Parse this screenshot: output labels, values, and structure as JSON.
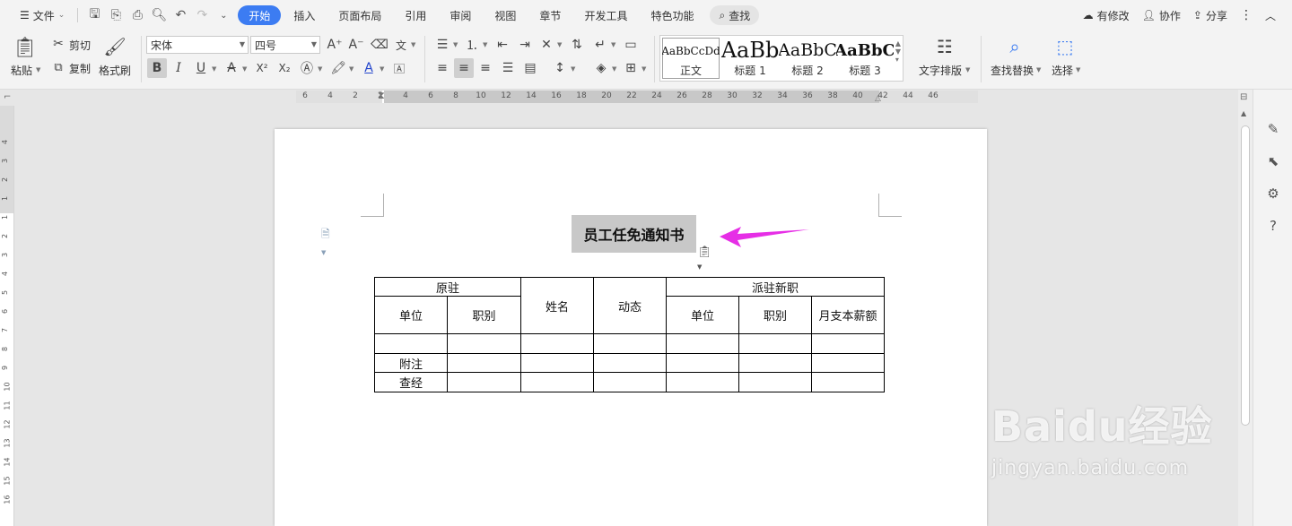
{
  "menubar": {
    "file_menu": "文件",
    "tabs": [
      "开始",
      "插入",
      "页面布局",
      "引用",
      "审阅",
      "视图",
      "章节",
      "开发工具",
      "特色功能"
    ],
    "active_tab": "开始",
    "search_label": "查找",
    "right": {
      "changes": "有修改",
      "collab": "协作",
      "share": "分享"
    }
  },
  "ribbon": {
    "paste": "粘贴",
    "cut": "剪切",
    "copy": "复制",
    "format_painter": "格式刷",
    "font_name": "宋体",
    "font_size": "四号",
    "styles": [
      {
        "preview": "AaBbCcDd",
        "name": "正文"
      },
      {
        "preview": "AaBb",
        "name": "标题 1"
      },
      {
        "preview": "AaBbC",
        "name": "标题 2"
      },
      {
        "preview": "AaBbC",
        "name": "标题 3"
      }
    ],
    "text_layout": "文字排版",
    "find_replace": "查找替换",
    "select": "选择"
  },
  "hruler_ticks": [
    "6",
    "4",
    "2",
    "2",
    "4",
    "6",
    "8",
    "10",
    "12",
    "14",
    "16",
    "18",
    "20",
    "22",
    "24",
    "26",
    "28",
    "30",
    "32",
    "34",
    "36",
    "38",
    "40",
    "42",
    "44",
    "46"
  ],
  "vruler_ticks": [
    "4",
    "3",
    "2",
    "1",
    "1",
    "2",
    "3",
    "4",
    "5",
    "6",
    "7",
    "8",
    "9",
    "10",
    "11",
    "12",
    "13",
    "14",
    "15",
    "16"
  ],
  "document": {
    "title": "员工任免通知书",
    "table": {
      "row1": {
        "original_post": "原驻",
        "name": "姓名",
        "movement": "动态",
        "new_post": "派驻新职"
      },
      "row2": {
        "unit": "单位",
        "rank": "职别",
        "unit2": "单位",
        "rank2": "职别",
        "salary": "月支本薪额"
      },
      "row4_label": "附注",
      "row5_label": "查经"
    }
  },
  "watermark": {
    "logo": "Baidu经验",
    "url": "jingyan.baidu.com"
  },
  "colors": {
    "accent": "#3c7cf2",
    "arrow": "#e62ee6"
  }
}
